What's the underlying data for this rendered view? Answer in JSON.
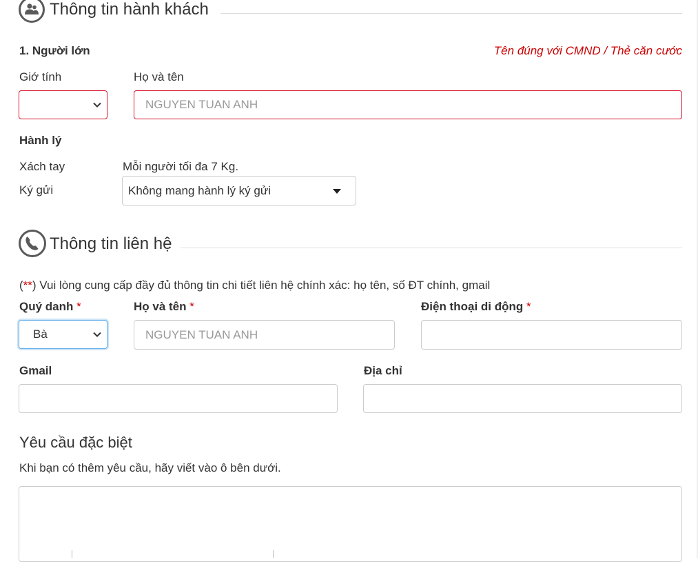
{
  "passenger": {
    "title": "Thông tin hành khách",
    "icon": "people-icon",
    "adult_label": "1. Người lớn",
    "name_hint": "Tên đúng với CMND / Thẻ căn cước",
    "gender_label": "Giớ tính",
    "gender_value": "",
    "fullname_label": "Họ và tên",
    "fullname_placeholder": "NGUYEN TUAN ANH",
    "baggage": {
      "title": "Hành lý",
      "carry_on_label": "Xách tay",
      "carry_on_value": "Mỗi người tối đa 7 Kg.",
      "checked_label": "Ký gửi",
      "checked_value": "Không mang hành lý ký gửi"
    }
  },
  "contact": {
    "title": "Thông tin liên hệ",
    "icon": "phone-icon",
    "note_prefix": "(",
    "note_stars": "**",
    "note_text": ") Vui lòng cung cấp đầy đủ thông tin chi tiết liên hệ chính xác: họ tên, số ĐT chính, gmail",
    "salutation_label": "Quý danh",
    "salutation_value": "Bà",
    "fullname_label": "Họ và tên",
    "fullname_placeholder": "NGUYEN TUAN ANH",
    "phone_label": "Điện thoại di động",
    "required_mark": "*",
    "gmail_label": "Gmail",
    "address_label": "Địa chỉ"
  },
  "special": {
    "title": "Yêu cầu đặc biệt",
    "description": "Khi bạn có thêm yêu cầu, hãy viết vào ô bên dưới."
  },
  "colors": {
    "error_border": "#d8152c",
    "required": "#cc0000",
    "focus": "#66afe9"
  }
}
